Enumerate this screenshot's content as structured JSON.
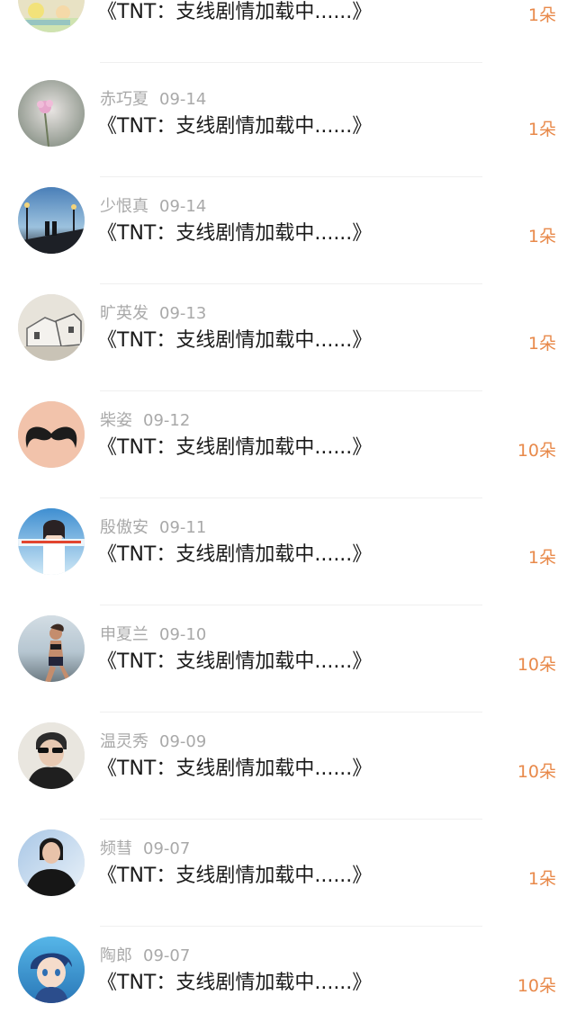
{
  "gifts": {
    "items": [
      {
        "name": "",
        "date": "",
        "title": "《TNT：支线剧情加载中......》",
        "count": "1朵",
        "avatar": "avatar-flower-text"
      },
      {
        "name": "赤巧夏",
        "date": "09-14",
        "title": "《TNT：支线剧情加载中......》",
        "count": "1朵",
        "avatar": "avatar-pink-flower"
      },
      {
        "name": "少恨真",
        "date": "09-14",
        "title": "《TNT：支线剧情加载中......》",
        "count": "1朵",
        "avatar": "avatar-couple-bridge"
      },
      {
        "name": "旷英发",
        "date": "09-13",
        "title": "《TNT：支线剧情加载中......》",
        "count": "1朵",
        "avatar": "avatar-house-sketch"
      },
      {
        "name": "柴姿",
        "date": "09-12",
        "title": "《TNT：支线剧情加载中......》",
        "count": "10朵",
        "avatar": "avatar-mustache"
      },
      {
        "name": "殷傲安",
        "date": "09-11",
        "title": "《TNT：支线剧情加载中......》",
        "count": "1朵",
        "avatar": "avatar-girl-text"
      },
      {
        "name": "申夏兰",
        "date": "09-10",
        "title": "《TNT：支线剧情加载中......》",
        "count": "10朵",
        "avatar": "avatar-runner"
      },
      {
        "name": "温灵秀",
        "date": "09-09",
        "title": "《TNT：支线剧情加载中......》",
        "count": "10朵",
        "avatar": "avatar-sunglasses"
      },
      {
        "name": "频彗",
        "date": "09-07",
        "title": "《TNT：支线剧情加载中......》",
        "count": "1朵",
        "avatar": "avatar-woman-dark"
      },
      {
        "name": "陶郎",
        "date": "09-07",
        "title": "《TNT：支线剧情加载中......》",
        "count": "10朵",
        "avatar": "avatar-anime-boy"
      }
    ]
  }
}
